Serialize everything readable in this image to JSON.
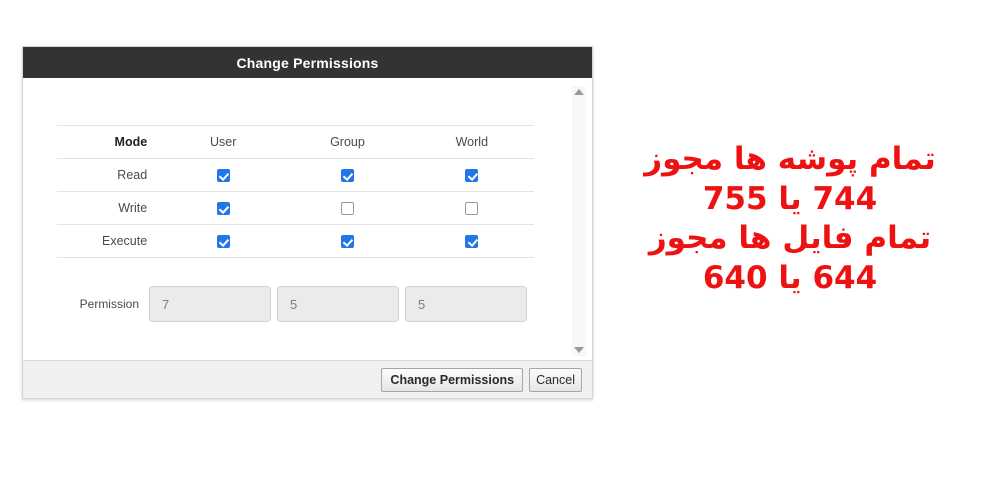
{
  "dialog": {
    "title": "Change Permissions",
    "table": {
      "headers": [
        "Mode",
        "User",
        "Group",
        "World"
      ],
      "rows": [
        {
          "mode": "Read",
          "user": true,
          "group": true,
          "world": true
        },
        {
          "mode": "Write",
          "user": true,
          "group": false,
          "world": false
        },
        {
          "mode": "Execute",
          "user": true,
          "group": true,
          "world": true
        }
      ]
    },
    "permission": {
      "label": "Permission",
      "user_value": "7",
      "group_value": "5",
      "world_value": "5"
    },
    "footer": {
      "submit_label": "Change Permissions",
      "cancel_label": "Cancel"
    },
    "scrollbar": {
      "up_icon": "scroll-up-arrow-icon",
      "down_icon": "scroll-down-arrow-icon"
    }
  },
  "annotation": {
    "lines": [
      "تمام پوشه ها مجوز",
      "744 یا 755",
      "تمام فایل ها مجوز",
      "644 یا 640"
    ],
    "color": "#ee1111"
  },
  "colors": {
    "titlebar_bg": "#333333",
    "checkbox_checked": "#2176e8",
    "footer_bg": "#f0f0f0",
    "input_bg": "#ebebeb"
  }
}
